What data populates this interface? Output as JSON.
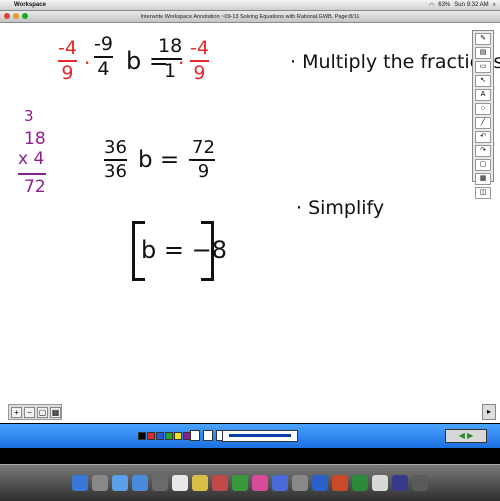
{
  "menubar": {
    "app_name": "Workspace",
    "battery": "63%",
    "clock": "Sun 9:32 AM"
  },
  "window": {
    "title": "Interwrite Workspace Annotation ~09-13 Solving Equations with Rational.GWB, Page:8/11"
  },
  "equation1": {
    "lhs_num": "-4",
    "lhs_den": "9",
    "dot1": "·",
    "coef_num": "-9",
    "coef_den": "4",
    "var": "b =",
    "rhs_num": "18",
    "rhs_den": "1",
    "dot2": "·",
    "mult_num": "-4",
    "mult_den": "9"
  },
  "note1": "· Multiply the fractions",
  "side_work": {
    "carry": "3",
    "top": "18",
    "mult": "x 4",
    "result": "72"
  },
  "equation2": {
    "coef_num": "36",
    "coef_den": "36",
    "var": "b = −",
    "rhs_num": "72",
    "rhs_den": "9"
  },
  "note2": "· Simplify",
  "answer": "b = −8",
  "colors": {
    "red_ink": "#e22a2a",
    "black_ink": "#111111",
    "purple_ink": "#8b1f8e",
    "toolbar_blue": "#1b6fe0"
  }
}
